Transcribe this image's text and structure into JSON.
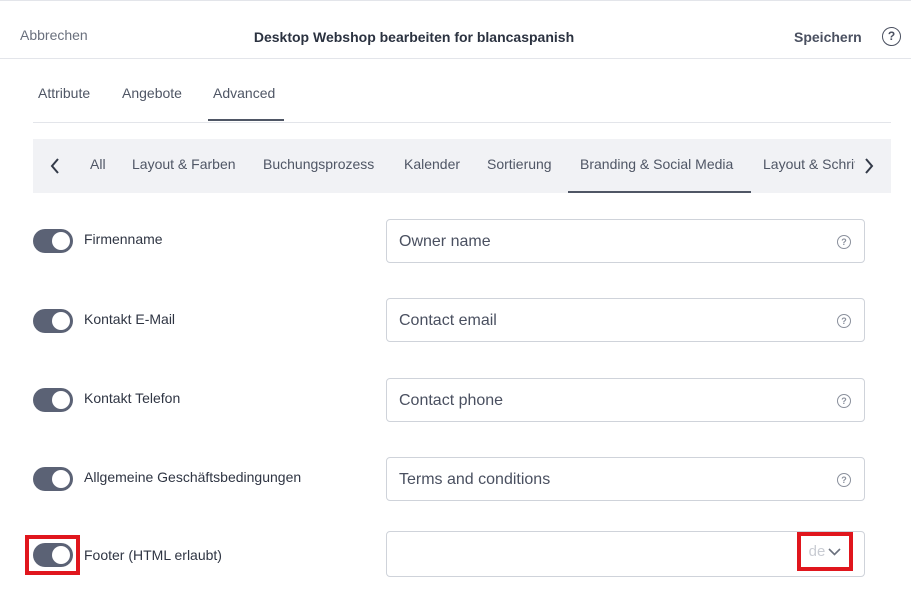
{
  "header": {
    "cancel_label": "Abbrechen",
    "title": "Desktop Webshop bearbeiten for blancaspanish",
    "save_label": "Speichern",
    "help_glyph": "?"
  },
  "tabs": [
    {
      "label": "Attribute"
    },
    {
      "label": "Angebote"
    },
    {
      "label": "Advanced",
      "active": true
    }
  ],
  "subnav": {
    "items": [
      {
        "label": "All"
      },
      {
        "label": "Layout & Farben"
      },
      {
        "label": "Buchungsprozess"
      },
      {
        "label": "Kalender"
      },
      {
        "label": "Sortierung"
      },
      {
        "label": "Branding & Social Media",
        "active": true
      },
      {
        "label": "Layout & Schrift"
      }
    ],
    "prev_icon": "chevron-left-icon",
    "next_icon": "chevron-right-icon"
  },
  "settings": [
    {
      "label": "Firmenname",
      "enabled": true,
      "value": "Owner name"
    },
    {
      "label": "Kontakt E-Mail",
      "enabled": true,
      "value": "Contact email"
    },
    {
      "label": "Kontakt Telefon",
      "enabled": true,
      "value": "Contact phone"
    },
    {
      "label": "Allgemeine Geschäftsbedingungen",
      "enabled": true,
      "value": "Terms and conditions"
    },
    {
      "label": "Footer (HTML erlaubt)",
      "enabled": true,
      "value": "",
      "language": "de"
    }
  ],
  "colors": {
    "accent": "#5b6275",
    "highlight": "#e0161d",
    "subnav_bg": "#f1f2f5"
  }
}
